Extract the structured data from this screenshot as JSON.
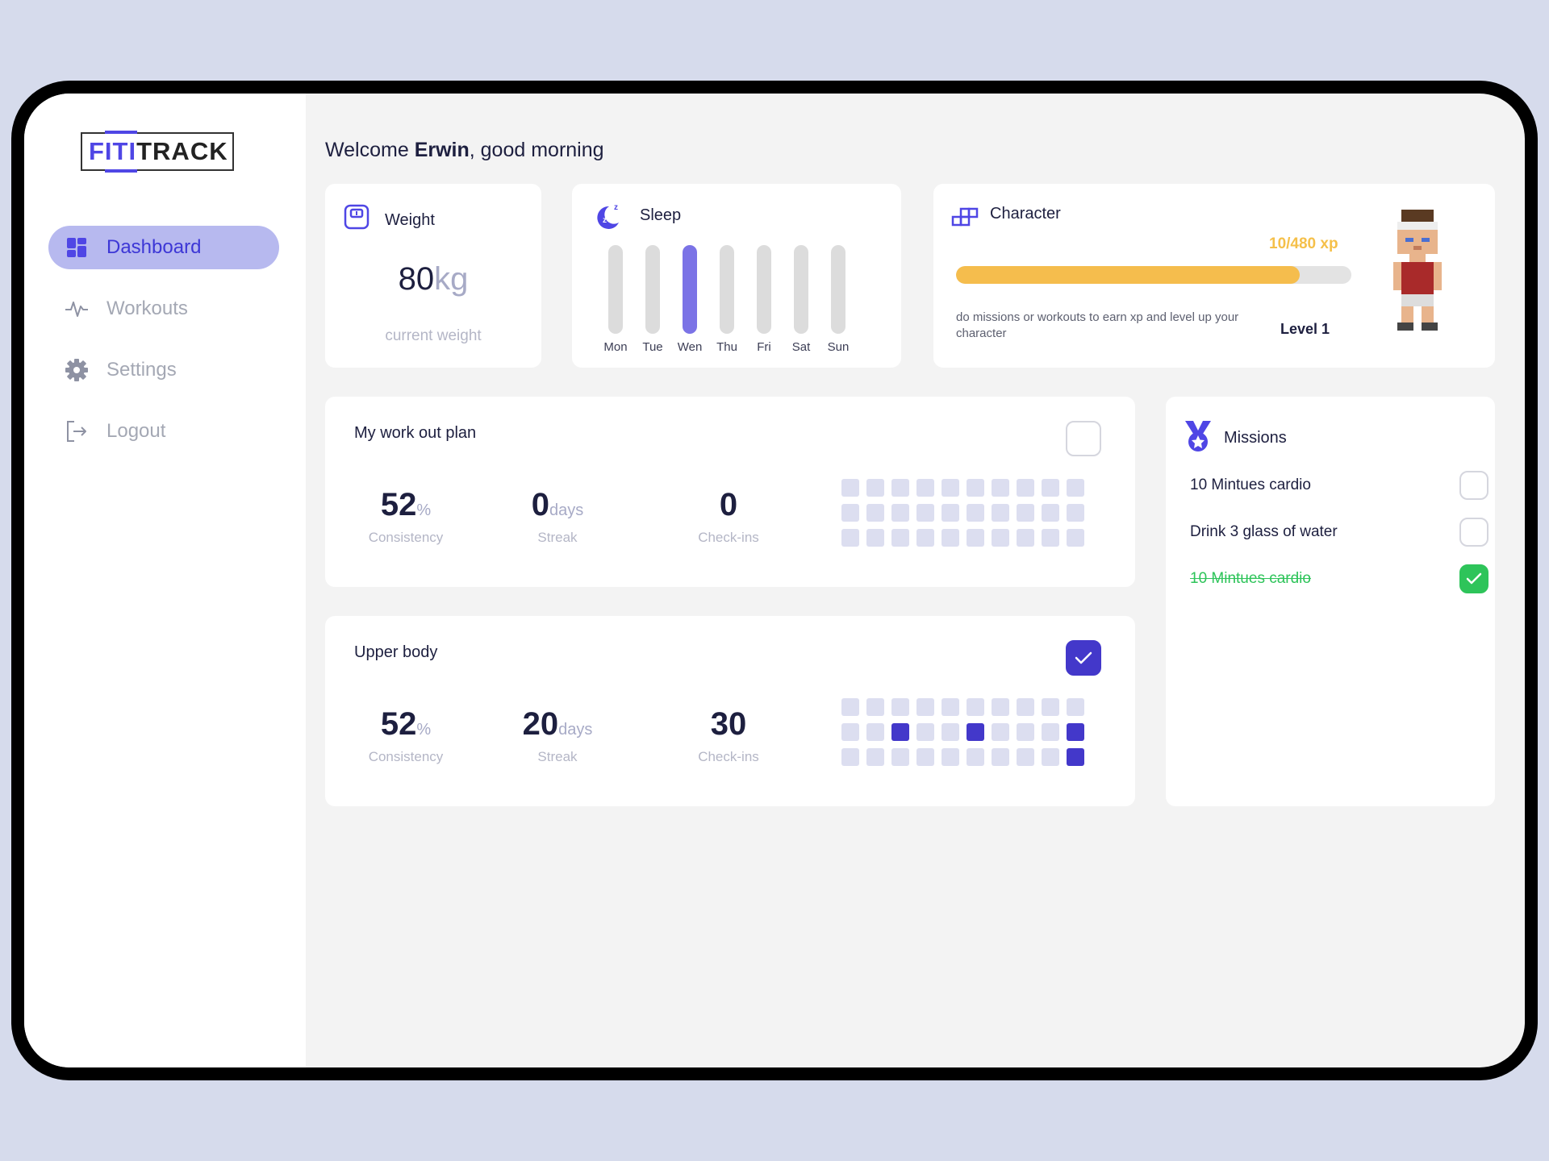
{
  "app": {
    "logo_prefix": "FITI",
    "logo_suffix": "TRACK"
  },
  "nav": {
    "items": [
      {
        "label": "Dashboard",
        "icon": "dashboard-icon",
        "active": true
      },
      {
        "label": "Workouts",
        "icon": "activity-icon",
        "active": false
      },
      {
        "label": "Settings",
        "icon": "gear-icon",
        "active": false
      },
      {
        "label": "Logout",
        "icon": "logout-icon",
        "active": false
      }
    ]
  },
  "greeting": {
    "prefix": "Welcome ",
    "name": "Erwin",
    "suffix": ", good morning"
  },
  "weight": {
    "title": "Weight",
    "value": "80",
    "unit": "kg",
    "subtitle": "current weight"
  },
  "sleep": {
    "title": "Sleep",
    "days": [
      "Mon",
      "Tue",
      "Wen",
      "Thu",
      "Fri",
      "Sat",
      "Sun"
    ],
    "highlighted_day": "Wen"
  },
  "character": {
    "title": "Character",
    "xp_label": "10/480 xp",
    "xp_progress": 0.87,
    "description": "do missions or workouts to earn xp and level up your character",
    "level": "Level 1"
  },
  "plans": [
    {
      "title": "My work out plan",
      "checked": false,
      "consistency": "52",
      "consistency_unit": "%",
      "consistency_label": "Consistency",
      "streak": "0",
      "streak_unit": "days",
      "streak_label": "Streak",
      "checkins": "0",
      "checkins_label": "Check-ins",
      "active_cells": []
    },
    {
      "title": "Upper body",
      "checked": true,
      "consistency": "52",
      "consistency_unit": "%",
      "consistency_label": "Consistency",
      "streak": "20",
      "streak_unit": "days",
      "streak_label": "Streak",
      "checkins": "30",
      "checkins_label": "Check-ins",
      "active_cells": [
        12,
        15,
        19,
        29
      ]
    }
  ],
  "missions": {
    "title": "Missions",
    "items": [
      {
        "label": "10 Mintues cardio",
        "done": false
      },
      {
        "label": "Drink 3 glass of water",
        "done": false
      },
      {
        "label": "10 Mintues cardio ",
        "done": true
      }
    ]
  },
  "colors": {
    "accent": "#4338ca",
    "nav_active_bg": "#b7b9ef",
    "xp": "#f5bd4d",
    "success": "#2ec45a"
  }
}
